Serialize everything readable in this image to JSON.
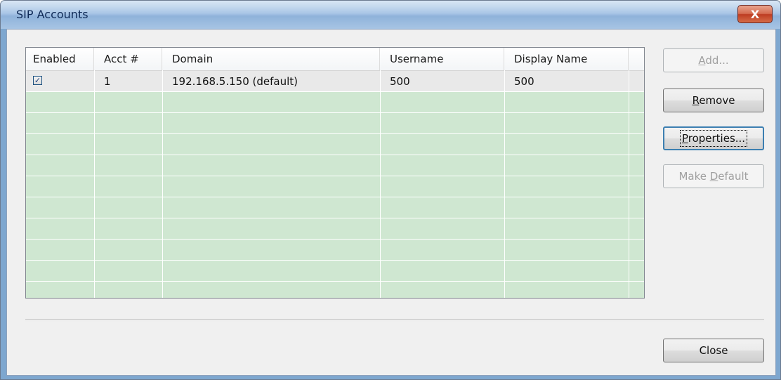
{
  "window": {
    "title": "SIP Accounts",
    "close_glyph": "X"
  },
  "table": {
    "columns": [
      "Enabled",
      "Acct #",
      "Domain",
      "Username",
      "Display Name"
    ],
    "rows": [
      {
        "enabled": true,
        "acct": "1",
        "domain": "192.168.5.150 (default)",
        "username": "500",
        "display_name": "500"
      }
    ]
  },
  "buttons": {
    "add": {
      "label": "Add...",
      "mnemonic": "A",
      "enabled": false
    },
    "remove": {
      "label": "Remove",
      "mnemonic": "R",
      "enabled": true
    },
    "properties": {
      "label": "Properties...",
      "mnemonic": "P",
      "enabled": true
    },
    "make_default": {
      "label": "Make Default",
      "mnemonic": "D",
      "enabled": false
    },
    "close": {
      "label": "Close",
      "enabled": true
    }
  },
  "colors": {
    "row_fill": "#cfe7d1",
    "title_text": "#0f2a57",
    "close_button": "#c9472a"
  },
  "icons": {
    "checkbox": "checkmark-icon",
    "close": "close-icon"
  }
}
